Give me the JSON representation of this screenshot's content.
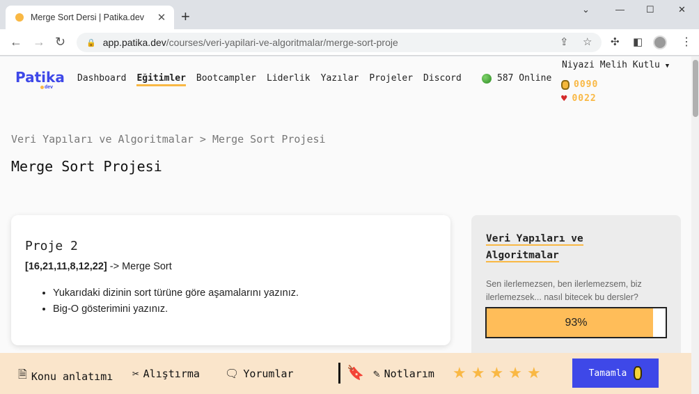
{
  "browser": {
    "tab_title": "Merge Sort Dersi | Patika.dev",
    "url_host": "app.patika.dev",
    "url_path": "/courses/veri-yapilari-ve-algoritmalar/merge-sort-proje"
  },
  "header": {
    "logo": "Patika",
    "logo_sub": "dev",
    "nav": [
      "Dashboard",
      "Eğitimler",
      "Bootcampler",
      "Liderlik",
      "Yazılar",
      "Projeler",
      "Discord"
    ],
    "active_nav": "Eğitimler",
    "online": "587 Online",
    "user": "Niyazi Melih Kutlu",
    "coins": "0090",
    "hearts": "0022"
  },
  "breadcrumb": "Veri Yapıları ve Algoritmalar > Merge Sort Projesi",
  "page_title": "Merge Sort Projesi",
  "card": {
    "heading": "Proje 2",
    "array": "[16,21,11,8,12,22]",
    "array_suffix": " -> Merge Sort",
    "bullets": [
      "Yukarıdaki dizinin sort türüne göre aşamalarını yazınız.",
      "Big-O gösterimini yazınız."
    ]
  },
  "sidebar": {
    "title_line1": "Veri Yapıları ve",
    "title_line2": "Algoritmalar",
    "quote": "Sen ilerlemezsen, ben ilerlemezsem, biz ilerlemezsek... nasıl bitecek bu dersler?",
    "progress": 93,
    "progress_label": "93%"
  },
  "bottombar": {
    "konu": "Konu anlatımı",
    "alistirma": "Alıştırma",
    "yorumlar": "Yorumlar",
    "notlarim": "Notlarım",
    "complete": "Tamamla",
    "accent": "#3e48e8",
    "star_color": "#f9b844"
  }
}
